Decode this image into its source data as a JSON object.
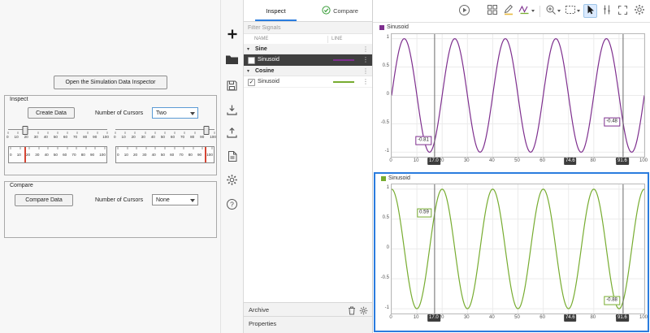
{
  "figure": {
    "open_button": "Open the Simulation Data Inspector",
    "inspect_panel": {
      "title": "Inspect",
      "create_button": "Create Data",
      "cursors_label": "Number of Cursors",
      "cursors_value": "Two",
      "axis_ticks": [
        "0",
        "10",
        "20",
        "30",
        "40",
        "50",
        "60",
        "70",
        "80",
        "90",
        "100"
      ],
      "cursor1": 17,
      "cursor2": 91.6
    },
    "compare_panel": {
      "title": "Compare",
      "compare_button": "Compare Data",
      "cursors_label": "Number of Cursors",
      "cursors_value": "None"
    }
  },
  "toolstrip": {
    "icons": [
      "add",
      "open",
      "save",
      "import",
      "export",
      "create-report",
      "preferences",
      "help"
    ]
  },
  "sdi": {
    "tabs": [
      {
        "label": "Inspect",
        "active": true
      },
      {
        "label": "Compare",
        "active": false
      }
    ],
    "filter_placeholder": "Filter Signals",
    "columns": {
      "name": "NAME",
      "line": "LINE"
    },
    "rows": [
      {
        "type": "group",
        "name": "Sine"
      },
      {
        "type": "signal",
        "name": "Sinusoid",
        "checked": false,
        "selected": true,
        "color": "#7E2F8E"
      },
      {
        "type": "group",
        "name": "Cosine"
      },
      {
        "type": "signal",
        "name": "Sinusoid",
        "checked": true,
        "selected": false,
        "color": "#77AC30"
      }
    ],
    "archive_label": "Archive",
    "properties_label": "Properties"
  },
  "plot_toolbar": {
    "icons": [
      "run",
      "layout",
      "highlight",
      "signal-style",
      "zoom",
      "fit-to-view",
      "pointer",
      "data-cursors",
      "maximize",
      "settings"
    ]
  },
  "colors": {
    "accent_blue": "#2a7cde",
    "selected_row_bg": "#3f3f3f",
    "badge_bg": "#3d3d3d",
    "cursor_line": "#6a6a6a",
    "tab_check_green": "#3a9e3a",
    "needle_red": "#d64533"
  },
  "chart_data": [
    {
      "type": "line",
      "legend": "Sinusoid",
      "series": [
        {
          "name": "Sinusoid",
          "color": "#7E2F8E",
          "waveform": "sin",
          "amplitude": 1,
          "period": 20
        }
      ],
      "xlim": [
        0,
        100
      ],
      "ylim": [
        -1.08,
        1.08
      ],
      "x_ticks": [
        "0",
        "10",
        "20",
        "30",
        "40",
        "50",
        "60",
        "70",
        "80",
        "90",
        "100"
      ],
      "y_ticks": [
        "1",
        "0.5",
        "0",
        "-0.5",
        "-1"
      ],
      "grid": true,
      "cursors": [
        {
          "time_label": "17.0",
          "x": 17,
          "value": -0.81,
          "value_label": "-0.81"
        },
        {
          "time_label": "91.6",
          "x": 91.6,
          "value": -0.48,
          "value_label": "-0.48"
        }
      ],
      "delta": {
        "label": "74.6",
        "x": 71
      },
      "selected": false
    },
    {
      "type": "line",
      "legend": "Sinusoid",
      "series": [
        {
          "name": "Sinusoid",
          "color": "#77AC30",
          "waveform": "cos",
          "amplitude": 1,
          "period": 20
        }
      ],
      "xlim": [
        0,
        100
      ],
      "ylim": [
        -1.08,
        1.08
      ],
      "x_ticks": [
        "0",
        "10",
        "20",
        "30",
        "40",
        "50",
        "60",
        "70",
        "80",
        "90",
        "100"
      ],
      "y_ticks": [
        "1",
        "0.5",
        "0",
        "-0.5",
        "-1"
      ],
      "grid": true,
      "cursors": [
        {
          "time_label": "17.0",
          "x": 17,
          "value": 0.59,
          "value_label": "0.59"
        },
        {
          "time_label": "91.6",
          "x": 91.6,
          "value": -0.88,
          "value_label": "-0.88"
        }
      ],
      "delta": {
        "label": "74.6",
        "x": 71
      },
      "selected": true
    }
  ]
}
